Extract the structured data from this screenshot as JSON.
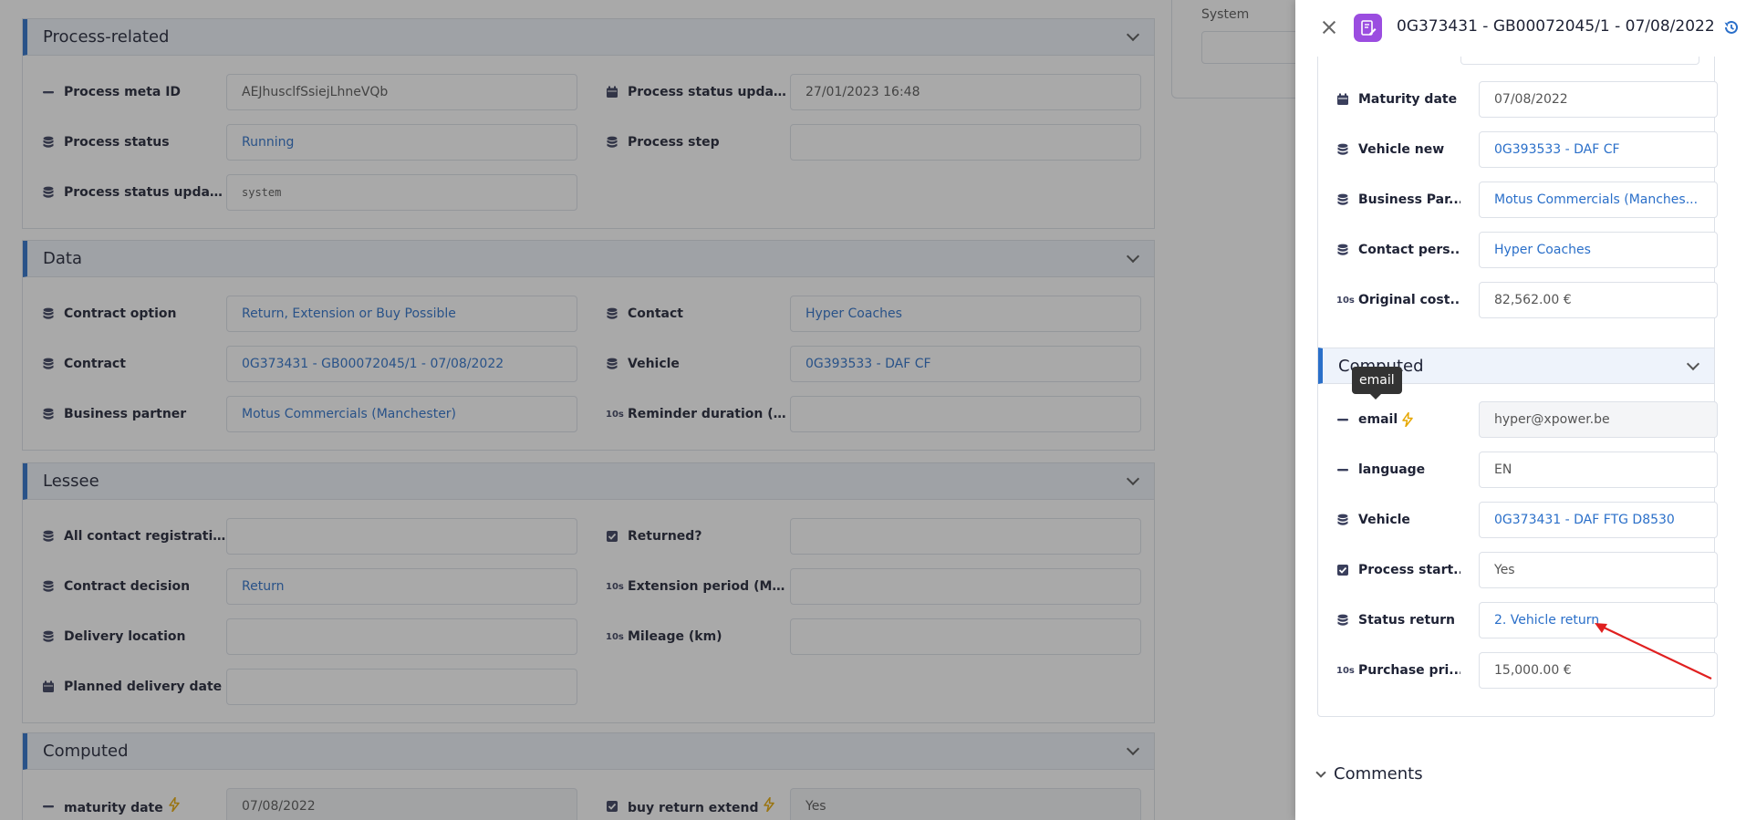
{
  "background": {
    "system_card": {
      "label": "System"
    },
    "sections": [
      {
        "title": "Process-related",
        "fields": [
          {
            "label": "Process meta ID",
            "value": "AEJhusclfSsiejLhneVQb",
            "icon": "dash-icon",
            "style": "plain"
          },
          {
            "label": "Process status update...",
            "value": "27/01/2023 16:48",
            "icon": "calendar-icon",
            "style": "plain"
          },
          {
            "label": "Process status",
            "value": "Running",
            "icon": "database-icon",
            "style": "link"
          },
          {
            "label": "Process step",
            "value": "",
            "icon": "database-icon",
            "style": "plain"
          },
          {
            "label": "Process status update...",
            "value": "system",
            "icon": "database-icon",
            "style": "mono"
          }
        ]
      },
      {
        "title": "Data",
        "fields": [
          {
            "label": "Contract option",
            "value": "Return, Extension or Buy Possible",
            "icon": "database-icon",
            "style": "link"
          },
          {
            "label": "Contact",
            "value": "Hyper Coaches",
            "icon": "database-icon",
            "style": "link"
          },
          {
            "label": "Contract",
            "value": "0G373431 - GB00072045/1 - 07/08/2022",
            "icon": "database-icon",
            "style": "link"
          },
          {
            "label": "Vehicle",
            "value": "0G393533 - DAF CF",
            "icon": "database-icon",
            "style": "link"
          },
          {
            "label": "Business partner",
            "value": "Motus Commercials (Manchester)",
            "icon": "database-icon",
            "style": "link"
          },
          {
            "label": "Reminder duration (d...",
            "value": "",
            "icon": "number-icon",
            "style": "plain"
          }
        ]
      },
      {
        "title": "Lessee",
        "fields": [
          {
            "label": "All contact registratio...",
            "value": "",
            "icon": "database-icon",
            "style": "plain"
          },
          {
            "label": "Returned?",
            "value": "",
            "icon": "checkbox-icon",
            "style": "plain"
          },
          {
            "label": "Contract decision",
            "value": "Return",
            "icon": "database-icon",
            "style": "link"
          },
          {
            "label": "Extension period (Mo...",
            "value": "",
            "icon": "number-icon",
            "style": "plain"
          },
          {
            "label": "Delivery location",
            "value": "",
            "icon": "database-icon",
            "style": "plain"
          },
          {
            "label": "Mileage (km)",
            "value": "",
            "icon": "number-icon",
            "style": "plain"
          },
          {
            "label": "Planned delivery date",
            "value": "",
            "icon": "calendar-icon",
            "style": "plain"
          }
        ]
      },
      {
        "title": "Computed",
        "fields": [
          {
            "label": "maturity date",
            "value": "07/08/2022",
            "icon": "dash-icon",
            "style": "ro",
            "bolt": true
          },
          {
            "label": "buy return extend",
            "value": "Yes",
            "icon": "checkbox-icon",
            "style": "ro",
            "bolt": true
          }
        ]
      }
    ]
  },
  "panel": {
    "title": "0G373431 - GB00072045/1 - 07/08/2022",
    "fields": [
      {
        "label": "Maturity date",
        "value": "07/08/2022",
        "icon": "calendar-icon",
        "style": "plain"
      },
      {
        "label": "Vehicle new",
        "value": "0G393533 - DAF CF",
        "icon": "database-icon",
        "style": "link"
      },
      {
        "label": "Business Par...",
        "value": "Motus Commercials (Manches...",
        "icon": "database-icon",
        "style": "link"
      },
      {
        "label": "Contact pers...",
        "value": "Hyper Coaches",
        "icon": "database-icon",
        "style": "link"
      },
      {
        "label": "Original cost...",
        "value": "82,562.00 €",
        "icon": "number-icon",
        "style": "plain"
      }
    ],
    "computed_title": "Computed",
    "computed_fields": [
      {
        "label": "email",
        "value": "hyper@xpower.be",
        "icon": "dash-icon",
        "style": "ro",
        "bolt": true
      },
      {
        "label": "language",
        "value": "EN",
        "icon": "dash-icon",
        "style": "plain"
      },
      {
        "label": "Vehicle",
        "value": "0G373431 - DAF FTG D8530",
        "icon": "database-icon",
        "style": "link"
      },
      {
        "label": "Process start...",
        "value": "Yes",
        "icon": "checkbox-icon",
        "style": "plain"
      },
      {
        "label": "Status return",
        "value": "2. Vehicle return",
        "icon": "database-icon",
        "style": "link"
      },
      {
        "label": "Purchase pri...",
        "value": "15,000.00 €",
        "icon": "number-icon",
        "style": "plain"
      }
    ],
    "tooltip": "email",
    "comments_label": "Comments"
  },
  "icons": {
    "number_glyph": "10s",
    "bolt_color": "#e6a700",
    "accent": "#2a6fc9",
    "badge_color": "#9b4de0",
    "arrow_color": "#e02020"
  }
}
